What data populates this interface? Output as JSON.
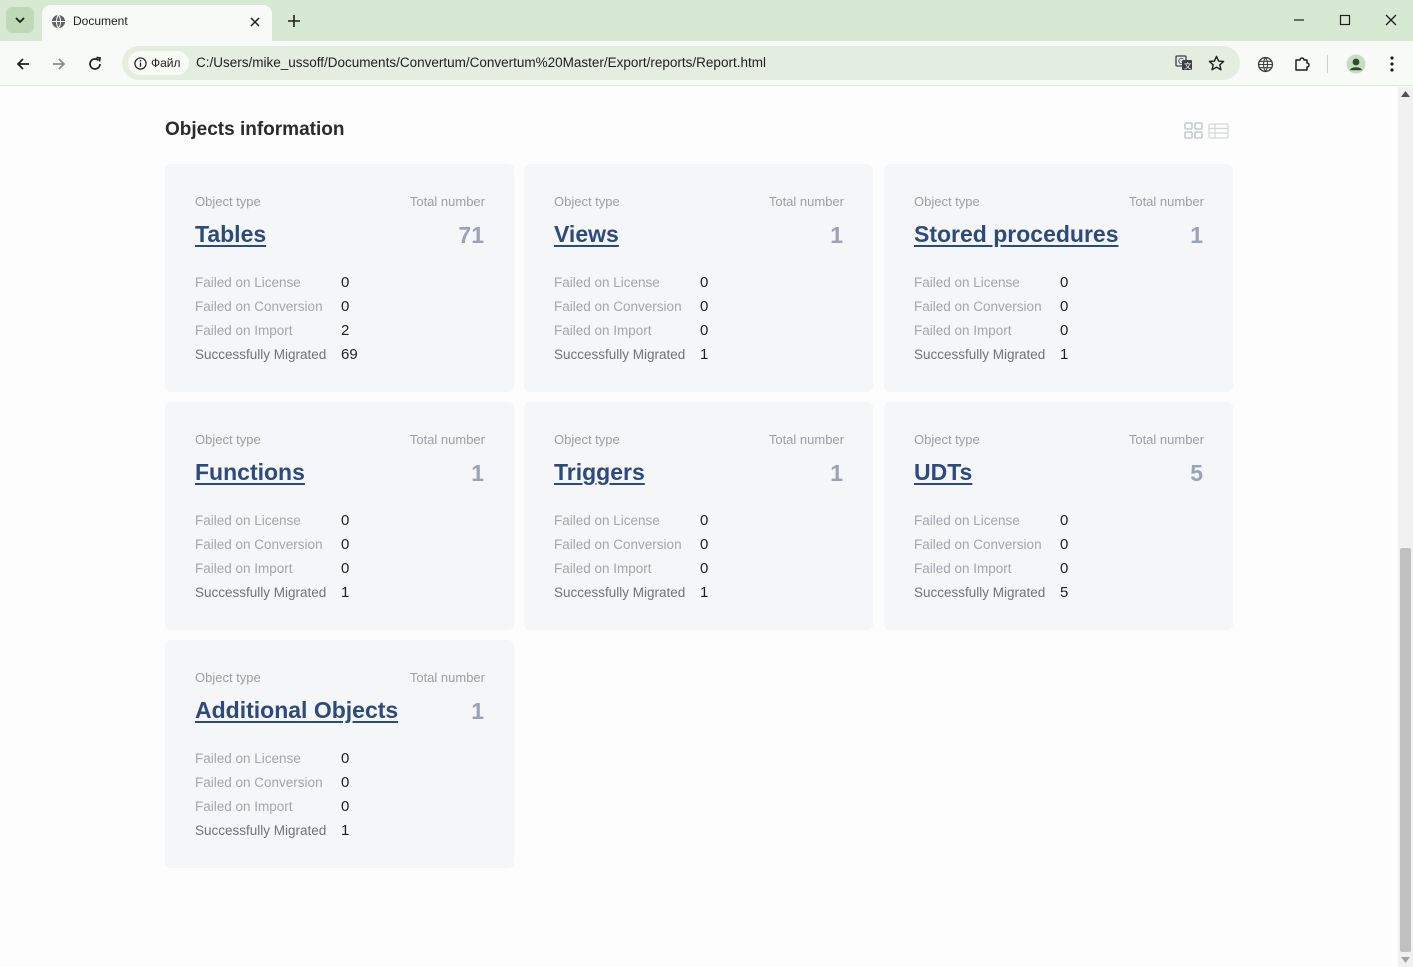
{
  "browser": {
    "tab_title": "Document",
    "chip_label": "Файл",
    "url": "C:/Users/mike_ussoff/Documents/Convertum/Convertum%20Master/Export/reports/Report.html"
  },
  "page": {
    "title": "Objects information"
  },
  "labels": {
    "object_type": "Object type",
    "total_number": "Total number",
    "failed_license": "Failed on License",
    "failed_conversion": "Failed on Conversion",
    "failed_import": "Failed on Import",
    "migrated": "Successfully Migrated"
  },
  "cards": [
    {
      "name": "Tables",
      "total": "71",
      "failed_license": "0",
      "failed_conversion": "0",
      "failed_import": "2",
      "migrated": "69"
    },
    {
      "name": "Views",
      "total": "1",
      "failed_license": "0",
      "failed_conversion": "0",
      "failed_import": "0",
      "migrated": "1"
    },
    {
      "name": "Stored procedures",
      "total": "1",
      "failed_license": "0",
      "failed_conversion": "0",
      "failed_import": "0",
      "migrated": "1"
    },
    {
      "name": "Functions",
      "total": "1",
      "failed_license": "0",
      "failed_conversion": "0",
      "failed_import": "0",
      "migrated": "1"
    },
    {
      "name": "Triggers",
      "total": "1",
      "failed_license": "0",
      "failed_conversion": "0",
      "failed_import": "0",
      "migrated": "1"
    },
    {
      "name": "UDTs",
      "total": "5",
      "failed_license": "0",
      "failed_conversion": "0",
      "failed_import": "0",
      "migrated": "5"
    },
    {
      "name": "Additional Objects",
      "total": "1",
      "failed_license": "0",
      "failed_conversion": "0",
      "failed_import": "0",
      "migrated": "1"
    }
  ],
  "colors": {
    "tabbar": "#d8e9d3",
    "card_bg": "#f5f6f8",
    "link": "#2d4a7c",
    "total": "#9aa3b5"
  }
}
